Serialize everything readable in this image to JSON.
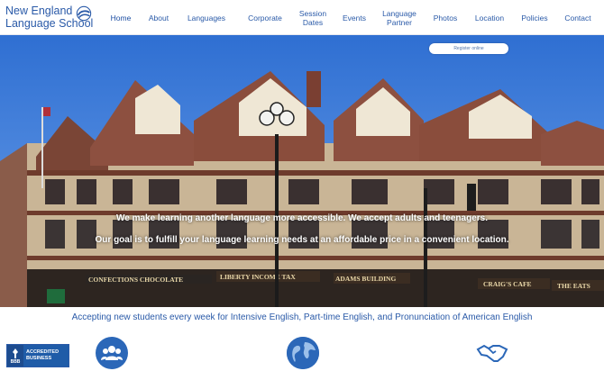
{
  "header": {
    "logo_line1": "New England",
    "logo_line2": "Language School",
    "nav": [
      {
        "label": "Home",
        "icon": ""
      },
      {
        "label": "About"
      },
      {
        "label": "Languages"
      },
      {
        "label": "Corporate"
      },
      {
        "label": "Session\nDates"
      },
      {
        "label": "Events"
      },
      {
        "label": "Language\nPartner"
      },
      {
        "label": "Photos"
      },
      {
        "label": "Location"
      },
      {
        "label": "Policies"
      },
      {
        "label": "Contact"
      }
    ]
  },
  "hero": {
    "register_label": "Register online",
    "line1": "We make learning another language more accessible. We accept adults and teenagers.",
    "line2": "Our goal is to fulfill your language learning needs at an affordable price in a convenient location.",
    "storefront_signs": [
      "CONFECTIONS CHOCOLATE",
      "LIBERTY INCOME TAX",
      "ADAMS BUILDING",
      "CRAIG'S CAFE",
      "THE EATS"
    ]
  },
  "announcement": "Accepting new students every week for Intensive English, Part-time English, and Pronunciation of American English",
  "badges": {
    "bbb_mark": "BBB",
    "bbb_line1": "ACCREDITED",
    "bbb_line2": "BUSINESS",
    "icons": [
      "people-icon",
      "globe-icon",
      "handshake-icon"
    ]
  },
  "colors": {
    "brand_blue": "#2a5aa8",
    "sky": "#3b78d6",
    "white": "#ffffff"
  }
}
